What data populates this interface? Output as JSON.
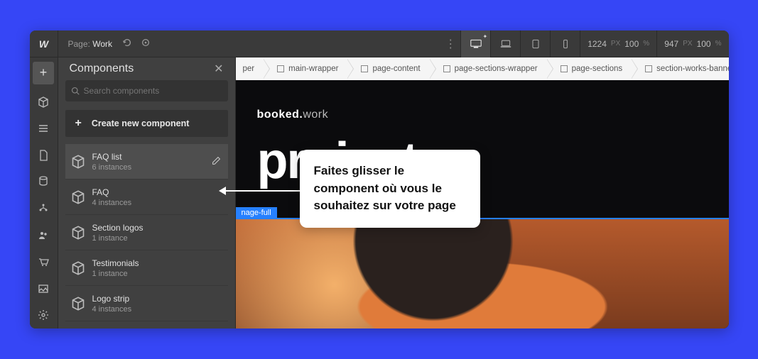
{
  "topbar": {
    "page_label_prefix": "Page:",
    "page_name": "Work",
    "dims": {
      "w": "1224",
      "w_unit": "PX",
      "w_pct": "100",
      "pct_unit": "%",
      "h": "947",
      "h_unit": "PX",
      "h_pct": "100"
    }
  },
  "panel": {
    "title": "Components",
    "search_placeholder": "Search components",
    "create_label": "Create new component",
    "items": [
      {
        "name": "FAQ list",
        "count": "6 instances"
      },
      {
        "name": "FAQ",
        "count": "4 instances"
      },
      {
        "name": "Section logos",
        "count": "1 instance"
      },
      {
        "name": "Testimonials",
        "count": "1 instance"
      },
      {
        "name": "Logo strip",
        "count": "4 instances"
      }
    ]
  },
  "breadcrumb": [
    "per",
    "main-wrapper",
    "page-content",
    "page-sections-wrapper",
    "page-sections",
    "section-works-banne"
  ],
  "site": {
    "brand_bold": "booked.",
    "brand_thin": "work",
    "hero": "projects",
    "selection_tag": "nage-full"
  },
  "callout": "Faites glisser le component où vous le souhaitez sur votre page"
}
